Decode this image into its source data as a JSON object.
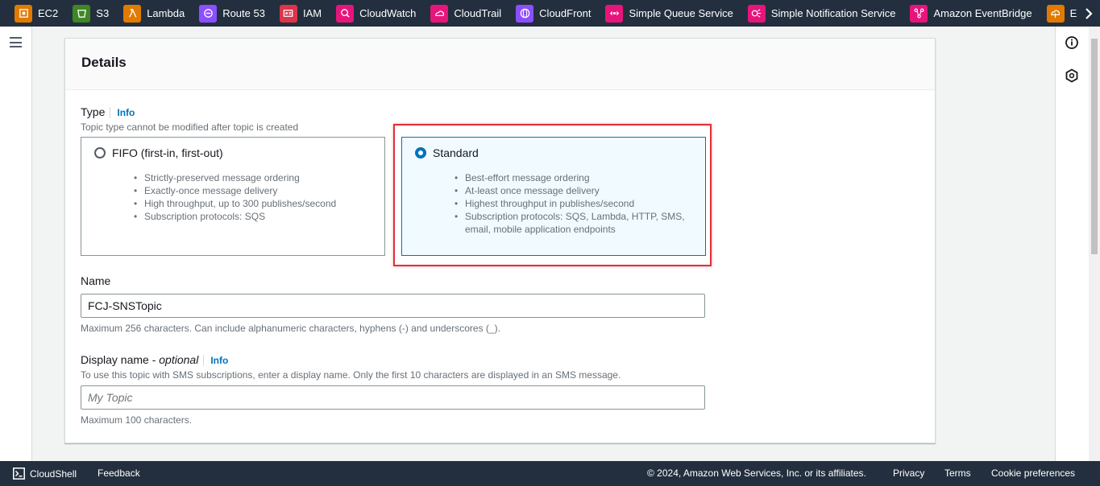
{
  "services": [
    {
      "label": "EC2",
      "icon": "ec2-icon",
      "color": "#e07b00"
    },
    {
      "label": "S3",
      "icon": "s3-icon",
      "color": "#3f8624"
    },
    {
      "label": "Lambda",
      "icon": "lambda-icon",
      "color": "#e07b00"
    },
    {
      "label": "Route 53",
      "icon": "route53-icon",
      "color": "#8c4fff"
    },
    {
      "label": "IAM",
      "icon": "iam-icon",
      "color": "#dd344c"
    },
    {
      "label": "CloudWatch",
      "icon": "cloudwatch-icon",
      "color": "#e7157b"
    },
    {
      "label": "CloudTrail",
      "icon": "cloudtrail-icon",
      "color": "#e7157b"
    },
    {
      "label": "CloudFront",
      "icon": "cloudfront-icon",
      "color": "#8c4fff"
    },
    {
      "label": "Simple Queue Service",
      "icon": "sqs-icon",
      "color": "#e7157b"
    },
    {
      "label": "Simple Notification Service",
      "icon": "sns-icon",
      "color": "#e7157b"
    },
    {
      "label": "Amazon EventBridge",
      "icon": "eventbridge-icon",
      "color": "#e7157b"
    },
    {
      "label": "Elastic Beans",
      "icon": "elastic-beanstalk-icon",
      "color": "#e07b00"
    }
  ],
  "details": {
    "title": "Details",
    "type": {
      "label": "Type",
      "info": "Info",
      "description": "Topic type cannot be modified after topic is created",
      "fifo": {
        "title": "FIFO (first-in, first-out)",
        "bullets": [
          "Strictly-preserved message ordering",
          "Exactly-once message delivery",
          "High throughput, up to 300 publishes/second",
          "Subscription protocols: SQS"
        ]
      },
      "standard": {
        "title": "Standard",
        "bullets": [
          "Best-effort message ordering",
          "At-least once message delivery",
          "Highest throughput in publishes/second",
          "Subscription protocols: SQS, Lambda, HTTP, SMS, email, mobile application endpoints"
        ]
      },
      "selected": "standard"
    },
    "name": {
      "label": "Name",
      "value": "FCJ-SNSTopic",
      "hint": "Maximum 256 characters. Can include alphanumeric characters, hyphens (-) and underscores (_)."
    },
    "display_name": {
      "label": "Display name - ",
      "optional": "optional",
      "info": "Info",
      "description": "To use this topic with SMS subscriptions, enter a display name. Only the first 10 characters are displayed in an SMS message.",
      "placeholder": "My Topic",
      "value": "",
      "hint": "Maximum 100 characters."
    }
  },
  "footer": {
    "cloudshell": "CloudShell",
    "feedback": "Feedback",
    "copyright": "© 2024, Amazon Web Services, Inc. or its affiliates.",
    "privacy": "Privacy",
    "terms": "Terms",
    "cookies": "Cookie preferences"
  },
  "colors": {
    "nav_bg": "#232f3e",
    "link": "#0073bb",
    "highlight": "#e0303a",
    "selected_tile_bg": "#f1faff"
  }
}
